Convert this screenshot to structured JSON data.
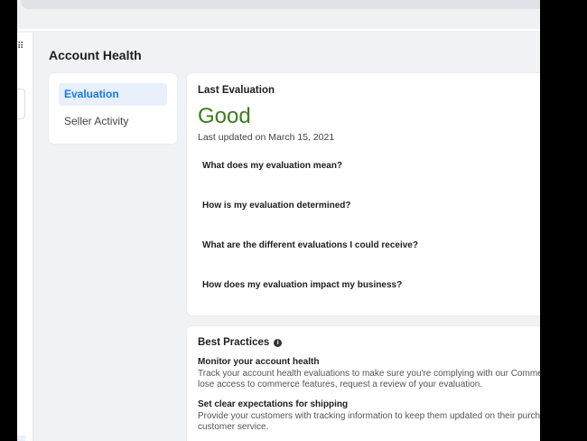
{
  "page_title": "Account Health",
  "menu": {
    "items": [
      {
        "label": "Evaluation",
        "active": true
      },
      {
        "label": "Seller Activity",
        "active": false
      }
    ]
  },
  "evaluation": {
    "heading": "Last Evaluation",
    "status": "Good",
    "status_color": "#3e7b1d",
    "updated": "Last updated on March 15, 2021",
    "questions": [
      "What does my evaluation mean?",
      "How is my evaluation determined?",
      "What are the different evaluations I could receive?",
      "How does my evaluation impact my business?"
    ]
  },
  "best_practices": {
    "heading": "Best Practices",
    "info_icon": "info-icon",
    "items": [
      {
        "title": "Monitor your account health",
        "text": "Track your account health evaluations to make sure you're complying with our Comme\nlose access to commerce features, request a review of your evaluation."
      },
      {
        "title": "Set clear expectations for shipping",
        "text": "Provide your customers with tracking information to keep them updated on their purch\ncustomer service."
      }
    ]
  }
}
